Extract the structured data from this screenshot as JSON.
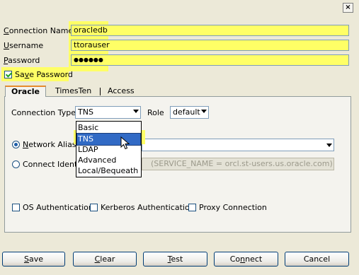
{
  "title_bar": {
    "close_glyph": "×"
  },
  "connection": {
    "name_label_prefix": "C",
    "name_label_rest": "onnection Name",
    "name_value": "oracledb",
    "username_label_prefix": "U",
    "username_label_rest": "sername",
    "username_value": "ttorauser",
    "password_label_prefix": "P",
    "password_label_rest": "assword",
    "password_value": "●●●●●●",
    "save_password_prefix": "Sa",
    "save_password_mnemonic": "v",
    "save_password_rest": "e Password",
    "save_password_checked": true
  },
  "tabs": [
    {
      "label": "Oracle",
      "active": true
    },
    {
      "label": "TimesTen",
      "active": false
    },
    {
      "label": "Access",
      "active": false
    }
  ],
  "oracle": {
    "connection_type_label": "Connection Type",
    "connection_type_value": "TNS",
    "role_label": "Role",
    "role_value": "default",
    "network_alias_prefix": "N",
    "network_alias_rest": "etwork Alias",
    "network_alias_selected": true,
    "network_alias_value": "",
    "connect_identifier_label": "Connect Identifi",
    "connect_identifier_value": "(SERVICE_NAME = orcl.st-users.us.oracle.com)   )  )",
    "os_auth_label": "OS Authentication",
    "kerberos_label": "Kerberos Authentication",
    "proxy_label": "Proxy Connection"
  },
  "dropdown_options": [
    "Basic",
    "TNS",
    "LDAP",
    "Advanced",
    "Local/Bequeath"
  ],
  "dropdown_selected": "TNS",
  "buttons": {
    "save": {
      "m": "S",
      "rest": "ave"
    },
    "clear": {
      "m": "C",
      "rest": "lear"
    },
    "test": {
      "m": "T",
      "rest": "est"
    },
    "connect": {
      "pre": "Co",
      "m": "n",
      "rest": "nect"
    },
    "cancel": "Cancel"
  },
  "colors": {
    "highlight": "#ffff66",
    "selection": "#316ac5",
    "tab_accent": "#e68b2c"
  }
}
